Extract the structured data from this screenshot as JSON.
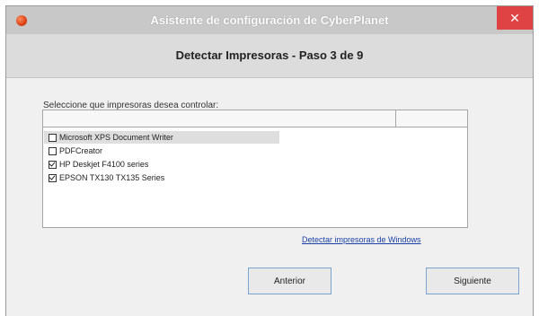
{
  "window": {
    "title": "Asistente de configuración de CyberPlanet",
    "close_glyph": "✕",
    "app_icon": "cyberplanet-logo-icon"
  },
  "header": {
    "step_title": "Detectar Impresoras - Paso 3 de 9"
  },
  "printers": {
    "instruction": "Seleccione que impresoras desea controlar:",
    "items": [
      {
        "label": "Microsoft XPS Document Writer",
        "checked": false,
        "selected": true
      },
      {
        "label": "PDFCreator",
        "checked": false,
        "selected": false
      },
      {
        "label": "HP Deskjet F4100 series",
        "checked": true,
        "selected": false
      },
      {
        "label": "EPSON TX130 TX135 Series",
        "checked": true,
        "selected": false
      }
    ],
    "detect_link": "Detectar impresoras de Windows"
  },
  "buttons": {
    "previous": "Anterior",
    "next": "Siguiente"
  },
  "colors": {
    "close_button": "#e04343",
    "link": "#1a3fa6",
    "button_border": "#7aa3d0"
  }
}
